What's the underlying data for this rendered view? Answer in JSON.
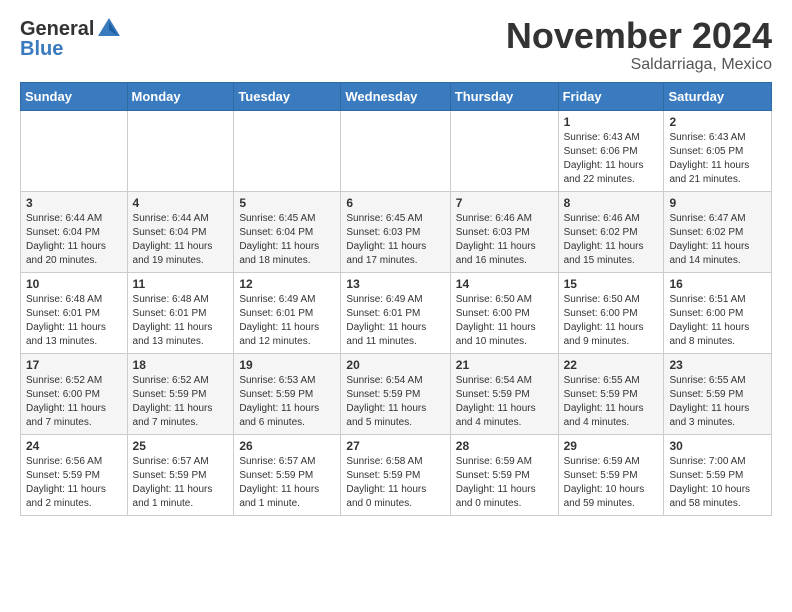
{
  "header": {
    "logo_general": "General",
    "logo_blue": "Blue",
    "month": "November 2024",
    "location": "Saldarriaga, Mexico"
  },
  "weekdays": [
    "Sunday",
    "Monday",
    "Tuesday",
    "Wednesday",
    "Thursday",
    "Friday",
    "Saturday"
  ],
  "weeks": [
    [
      {
        "day": "",
        "info": ""
      },
      {
        "day": "",
        "info": ""
      },
      {
        "day": "",
        "info": ""
      },
      {
        "day": "",
        "info": ""
      },
      {
        "day": "",
        "info": ""
      },
      {
        "day": "1",
        "info": "Sunrise: 6:43 AM\nSunset: 6:06 PM\nDaylight: 11 hours and 22 minutes."
      },
      {
        "day": "2",
        "info": "Sunrise: 6:43 AM\nSunset: 6:05 PM\nDaylight: 11 hours and 21 minutes."
      }
    ],
    [
      {
        "day": "3",
        "info": "Sunrise: 6:44 AM\nSunset: 6:04 PM\nDaylight: 11 hours and 20 minutes."
      },
      {
        "day": "4",
        "info": "Sunrise: 6:44 AM\nSunset: 6:04 PM\nDaylight: 11 hours and 19 minutes."
      },
      {
        "day": "5",
        "info": "Sunrise: 6:45 AM\nSunset: 6:04 PM\nDaylight: 11 hours and 18 minutes."
      },
      {
        "day": "6",
        "info": "Sunrise: 6:45 AM\nSunset: 6:03 PM\nDaylight: 11 hours and 17 minutes."
      },
      {
        "day": "7",
        "info": "Sunrise: 6:46 AM\nSunset: 6:03 PM\nDaylight: 11 hours and 16 minutes."
      },
      {
        "day": "8",
        "info": "Sunrise: 6:46 AM\nSunset: 6:02 PM\nDaylight: 11 hours and 15 minutes."
      },
      {
        "day": "9",
        "info": "Sunrise: 6:47 AM\nSunset: 6:02 PM\nDaylight: 11 hours and 14 minutes."
      }
    ],
    [
      {
        "day": "10",
        "info": "Sunrise: 6:48 AM\nSunset: 6:01 PM\nDaylight: 11 hours and 13 minutes."
      },
      {
        "day": "11",
        "info": "Sunrise: 6:48 AM\nSunset: 6:01 PM\nDaylight: 11 hours and 13 minutes."
      },
      {
        "day": "12",
        "info": "Sunrise: 6:49 AM\nSunset: 6:01 PM\nDaylight: 11 hours and 12 minutes."
      },
      {
        "day": "13",
        "info": "Sunrise: 6:49 AM\nSunset: 6:01 PM\nDaylight: 11 hours and 11 minutes."
      },
      {
        "day": "14",
        "info": "Sunrise: 6:50 AM\nSunset: 6:00 PM\nDaylight: 11 hours and 10 minutes."
      },
      {
        "day": "15",
        "info": "Sunrise: 6:50 AM\nSunset: 6:00 PM\nDaylight: 11 hours and 9 minutes."
      },
      {
        "day": "16",
        "info": "Sunrise: 6:51 AM\nSunset: 6:00 PM\nDaylight: 11 hours and 8 minutes."
      }
    ],
    [
      {
        "day": "17",
        "info": "Sunrise: 6:52 AM\nSunset: 6:00 PM\nDaylight: 11 hours and 7 minutes."
      },
      {
        "day": "18",
        "info": "Sunrise: 6:52 AM\nSunset: 5:59 PM\nDaylight: 11 hours and 7 minutes."
      },
      {
        "day": "19",
        "info": "Sunrise: 6:53 AM\nSunset: 5:59 PM\nDaylight: 11 hours and 6 minutes."
      },
      {
        "day": "20",
        "info": "Sunrise: 6:54 AM\nSunset: 5:59 PM\nDaylight: 11 hours and 5 minutes."
      },
      {
        "day": "21",
        "info": "Sunrise: 6:54 AM\nSunset: 5:59 PM\nDaylight: 11 hours and 4 minutes."
      },
      {
        "day": "22",
        "info": "Sunrise: 6:55 AM\nSunset: 5:59 PM\nDaylight: 11 hours and 4 minutes."
      },
      {
        "day": "23",
        "info": "Sunrise: 6:55 AM\nSunset: 5:59 PM\nDaylight: 11 hours and 3 minutes."
      }
    ],
    [
      {
        "day": "24",
        "info": "Sunrise: 6:56 AM\nSunset: 5:59 PM\nDaylight: 11 hours and 2 minutes."
      },
      {
        "day": "25",
        "info": "Sunrise: 6:57 AM\nSunset: 5:59 PM\nDaylight: 11 hours and 1 minute."
      },
      {
        "day": "26",
        "info": "Sunrise: 6:57 AM\nSunset: 5:59 PM\nDaylight: 11 hours and 1 minute."
      },
      {
        "day": "27",
        "info": "Sunrise: 6:58 AM\nSunset: 5:59 PM\nDaylight: 11 hours and 0 minutes."
      },
      {
        "day": "28",
        "info": "Sunrise: 6:59 AM\nSunset: 5:59 PM\nDaylight: 11 hours and 0 minutes."
      },
      {
        "day": "29",
        "info": "Sunrise: 6:59 AM\nSunset: 5:59 PM\nDaylight: 10 hours and 59 minutes."
      },
      {
        "day": "30",
        "info": "Sunrise: 7:00 AM\nSunset: 5:59 PM\nDaylight: 10 hours and 58 minutes."
      }
    ]
  ]
}
